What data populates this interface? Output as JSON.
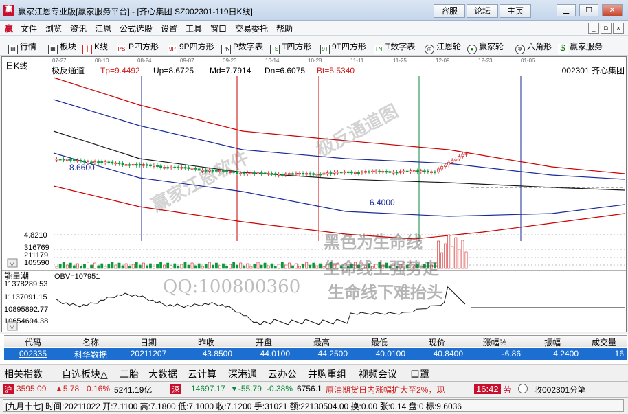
{
  "window": {
    "title": "赢家江恩专业版[赢家服务平台] - [齐心集团  SZ002301-119日K线]",
    "logo": "赢",
    "buttons": [
      "容服",
      "论坛",
      "主页"
    ],
    "controls": [
      "minimize-icon",
      "maximize-icon",
      "close-icon"
    ]
  },
  "menu": {
    "logo": "赢",
    "items": [
      "文件",
      "浏览",
      "资讯",
      "江恩",
      "公式选股",
      "设置",
      "工具",
      "窗口",
      "交易委托",
      "帮助"
    ],
    "mdi": [
      "_",
      "⧉",
      "×"
    ]
  },
  "toolbar": {
    "items": [
      {
        "icon": "bars-icon",
        "glyph": "▤",
        "label": "行情"
      },
      {
        "icon": "blocks-icon",
        "glyph": "▦",
        "label": "板块"
      },
      {
        "icon": "candle-icon",
        "glyph": "┃",
        "label": "K线"
      },
      {
        "icon": "ps-icon",
        "glyph": "PS",
        "label": "P四方形"
      },
      {
        "icon": "9p-icon",
        "glyph": "9P",
        "label": "9P四方形"
      },
      {
        "icon": "pn-icon",
        "glyph": "PN",
        "label": "P数字表"
      },
      {
        "icon": "ts-icon",
        "glyph": "TS",
        "label": "T四方形"
      },
      {
        "icon": "9t-icon",
        "glyph": "9T",
        "label": "9T四方形"
      },
      {
        "icon": "tn-icon",
        "glyph": "TN",
        "label": "T数字表"
      },
      {
        "icon": "wheel-icon",
        "glyph": "◎",
        "label": "江恩轮"
      },
      {
        "icon": "big-icon",
        "glyph": "●",
        "label": "赢家轮"
      },
      {
        "icon": "hexagon-icon",
        "glyph": "✲",
        "label": "六角形"
      },
      {
        "icon": "dollar-icon",
        "glyph": "$",
        "label": "赢家服务"
      }
    ]
  },
  "chart": {
    "period_label": "日K线",
    "indicator": "极反通道",
    "tp": "Tp=9.4492",
    "up": "Up=8.6725",
    "md": "Md=7.7914",
    "dn": "Dn=6.6075",
    "bt": "Bt=5.5340",
    "stock": "002301  齐心集团",
    "dates": [
      "07-27",
      "08-10",
      "08-24",
      "09-07",
      "09-23",
      "10-14",
      "10-28",
      "11-11",
      "11-25",
      "12-09",
      "12-23",
      "01-06"
    ],
    "high_label": "8.6600",
    "low_label": "6.4000",
    "price_scale": "4.8210",
    "volume_scale": [
      "316769",
      "211179",
      "105590"
    ],
    "obv_title": "能量潮",
    "obv_value": "OBV=107951",
    "obv_scale": [
      "11378289.53",
      "11137091.15",
      "10895892.77",
      "10654694.38"
    ],
    "colors": {
      "up": "#d02020",
      "down": "#0a9a3a",
      "outer": "#cc0000",
      "inner": "#1a2a9a",
      "mid": "#1a1a1a"
    }
  },
  "watermarks": {
    "wm1": "赢家江恩软件",
    "wm2": "极反通道图",
    "wm3": "黑色为生命线",
    "wm4": "生命线上强势走",
    "wm5": "生命线下难抬头",
    "wm6": "QQ:100800360"
  },
  "quote_table": {
    "headers": [
      "代码",
      "名称",
      "日期",
      "昨收",
      "开盘",
      "最高",
      "最低",
      "现价",
      "涨幅%",
      "振幅",
      "成交量"
    ],
    "row": [
      "002335",
      "科华数据",
      "20211207",
      "43.8500",
      "44.0100",
      "44.2500",
      "40.0100",
      "40.8400",
      "-6.86",
      "4.2400",
      "16"
    ]
  },
  "funcbar": {
    "items": [
      "相关指数",
      "自选板块△",
      "二胎",
      "大数据",
      "云计算",
      "深港通",
      "云办公",
      "并购重组",
      "视频会议",
      "口罩"
    ]
  },
  "status": {
    "sh_icon": "沪",
    "sh_index": "3595.09",
    "sh_change": "▲5.78",
    "sh_pct": "0.16%",
    "sh_amount": "5241.19亿",
    "sz_icon": "深",
    "sz_index": "14697.17",
    "sz_change": "▼-55.79",
    "sz_pct": "-0.38%",
    "sz_amount": "6756.1",
    "news": "原油期货日内涨幅扩大至2%，现",
    "time": "16:42",
    "alert_icon": "劳",
    "receive": "收002301分笔"
  },
  "status2": {
    "text": "[九月十七] 时间:20211022 开:7.1100 高:7.1800 低:7.1000 收:7.1200 手:31021 额:22130504.00 换:0.00 张:0.14 盘:0 标:9.6036"
  }
}
